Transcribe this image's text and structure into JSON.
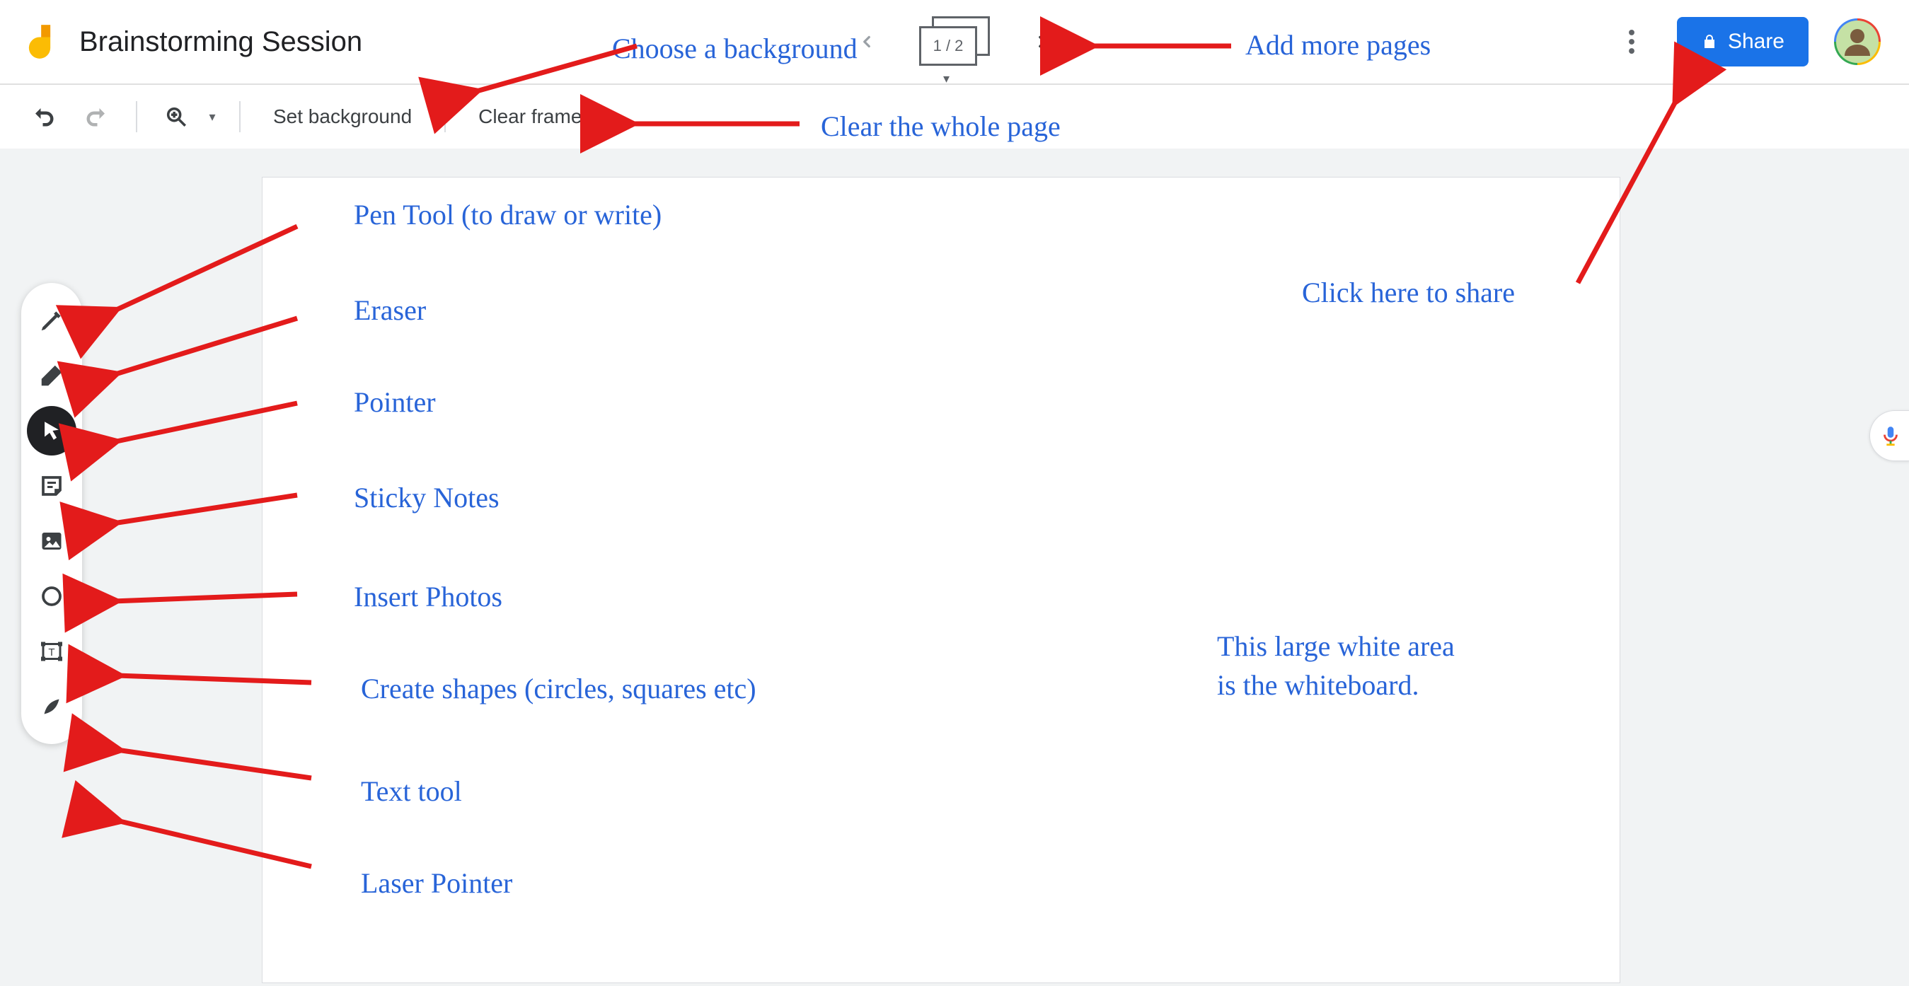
{
  "header": {
    "title": "Brainstorming Session",
    "page_indicator": "1 / 2",
    "share_label": "Share"
  },
  "toolbar": {
    "set_background_label": "Set background",
    "clear_frame_label": "Clear frame"
  },
  "tools": {
    "pen": "pen",
    "eraser": "eraser",
    "pointer": "pointer",
    "sticky": "sticky-note",
    "image": "image",
    "shape": "shape",
    "text": "text-box",
    "laser": "laser"
  },
  "annotations": {
    "choose_background": "Choose a background",
    "clear_page": "Clear the whole page",
    "add_pages": "Add more pages",
    "share": "Click here to share",
    "pen": "Pen Tool (to draw or write)",
    "eraser": "Eraser",
    "pointer": "Pointer",
    "sticky": "Sticky Notes",
    "photos": "Insert Photos",
    "shapes": "Create shapes (circles, squares etc)",
    "text": "Text tool",
    "laser": "Laser Pointer",
    "whiteboard_l1": "This large white area",
    "whiteboard_l2": "is the whiteboard."
  }
}
